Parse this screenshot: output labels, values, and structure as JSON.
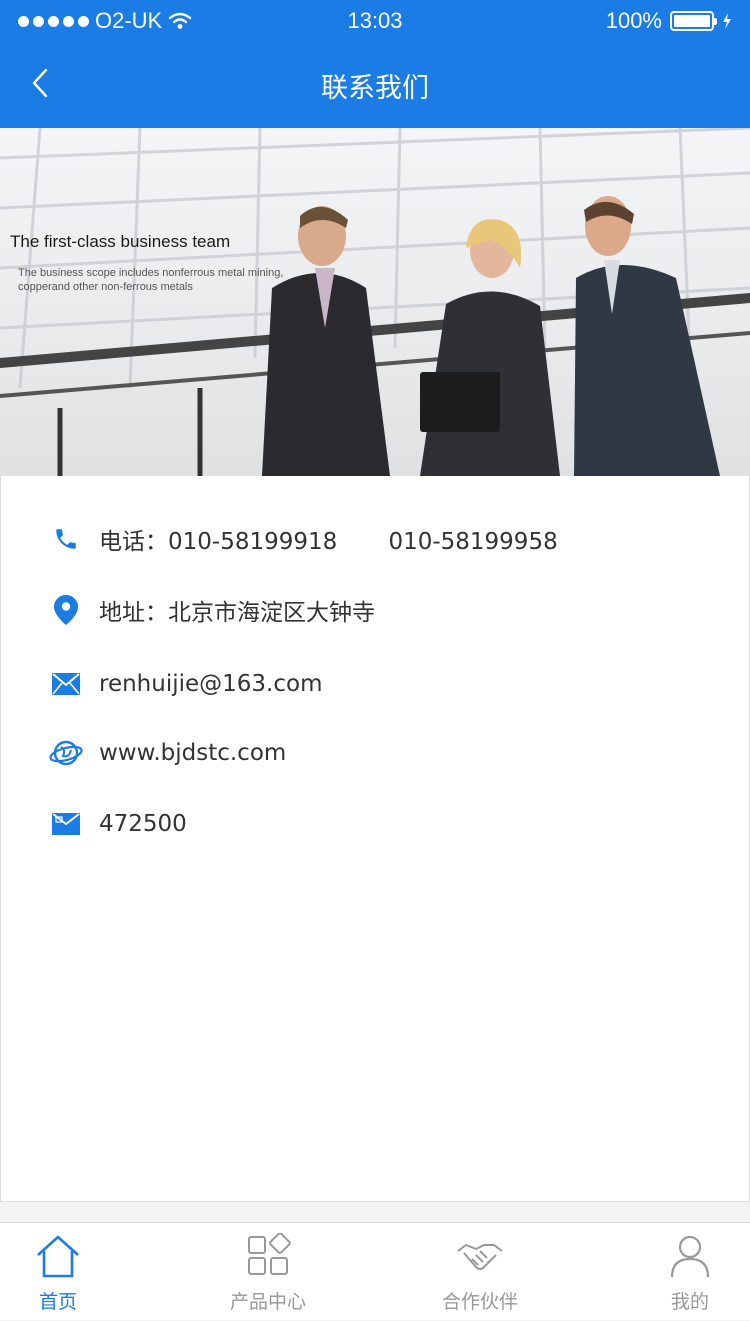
{
  "status_bar": {
    "carrier": "O2-UK",
    "time": "13:03",
    "battery": "100%"
  },
  "nav": {
    "title": "联系我们"
  },
  "banner": {
    "headline": "The first-class business team",
    "subtext": "The business scope includes nonferrous metal mining, copperand other non-ferrous metals"
  },
  "contact": {
    "phone": "电话：010-58199918       010-58199958",
    "address": "地址：北京市海淀区大钟寺",
    "email": "renhuijie@163.com",
    "website": "www.bjdstc.com",
    "postcode": "472500"
  },
  "tabs": [
    {
      "label": "首页",
      "icon": "home-icon",
      "active": true
    },
    {
      "label": "产品中心",
      "icon": "grid-icon",
      "active": false
    },
    {
      "label": "合作伙伴",
      "icon": "handshake-icon",
      "active": false
    },
    {
      "label": "我的",
      "icon": "user-icon",
      "active": false
    }
  ],
  "colors": {
    "primary": "#1b7ce6",
    "text": "#333333",
    "tab_inactive": "#999999"
  }
}
